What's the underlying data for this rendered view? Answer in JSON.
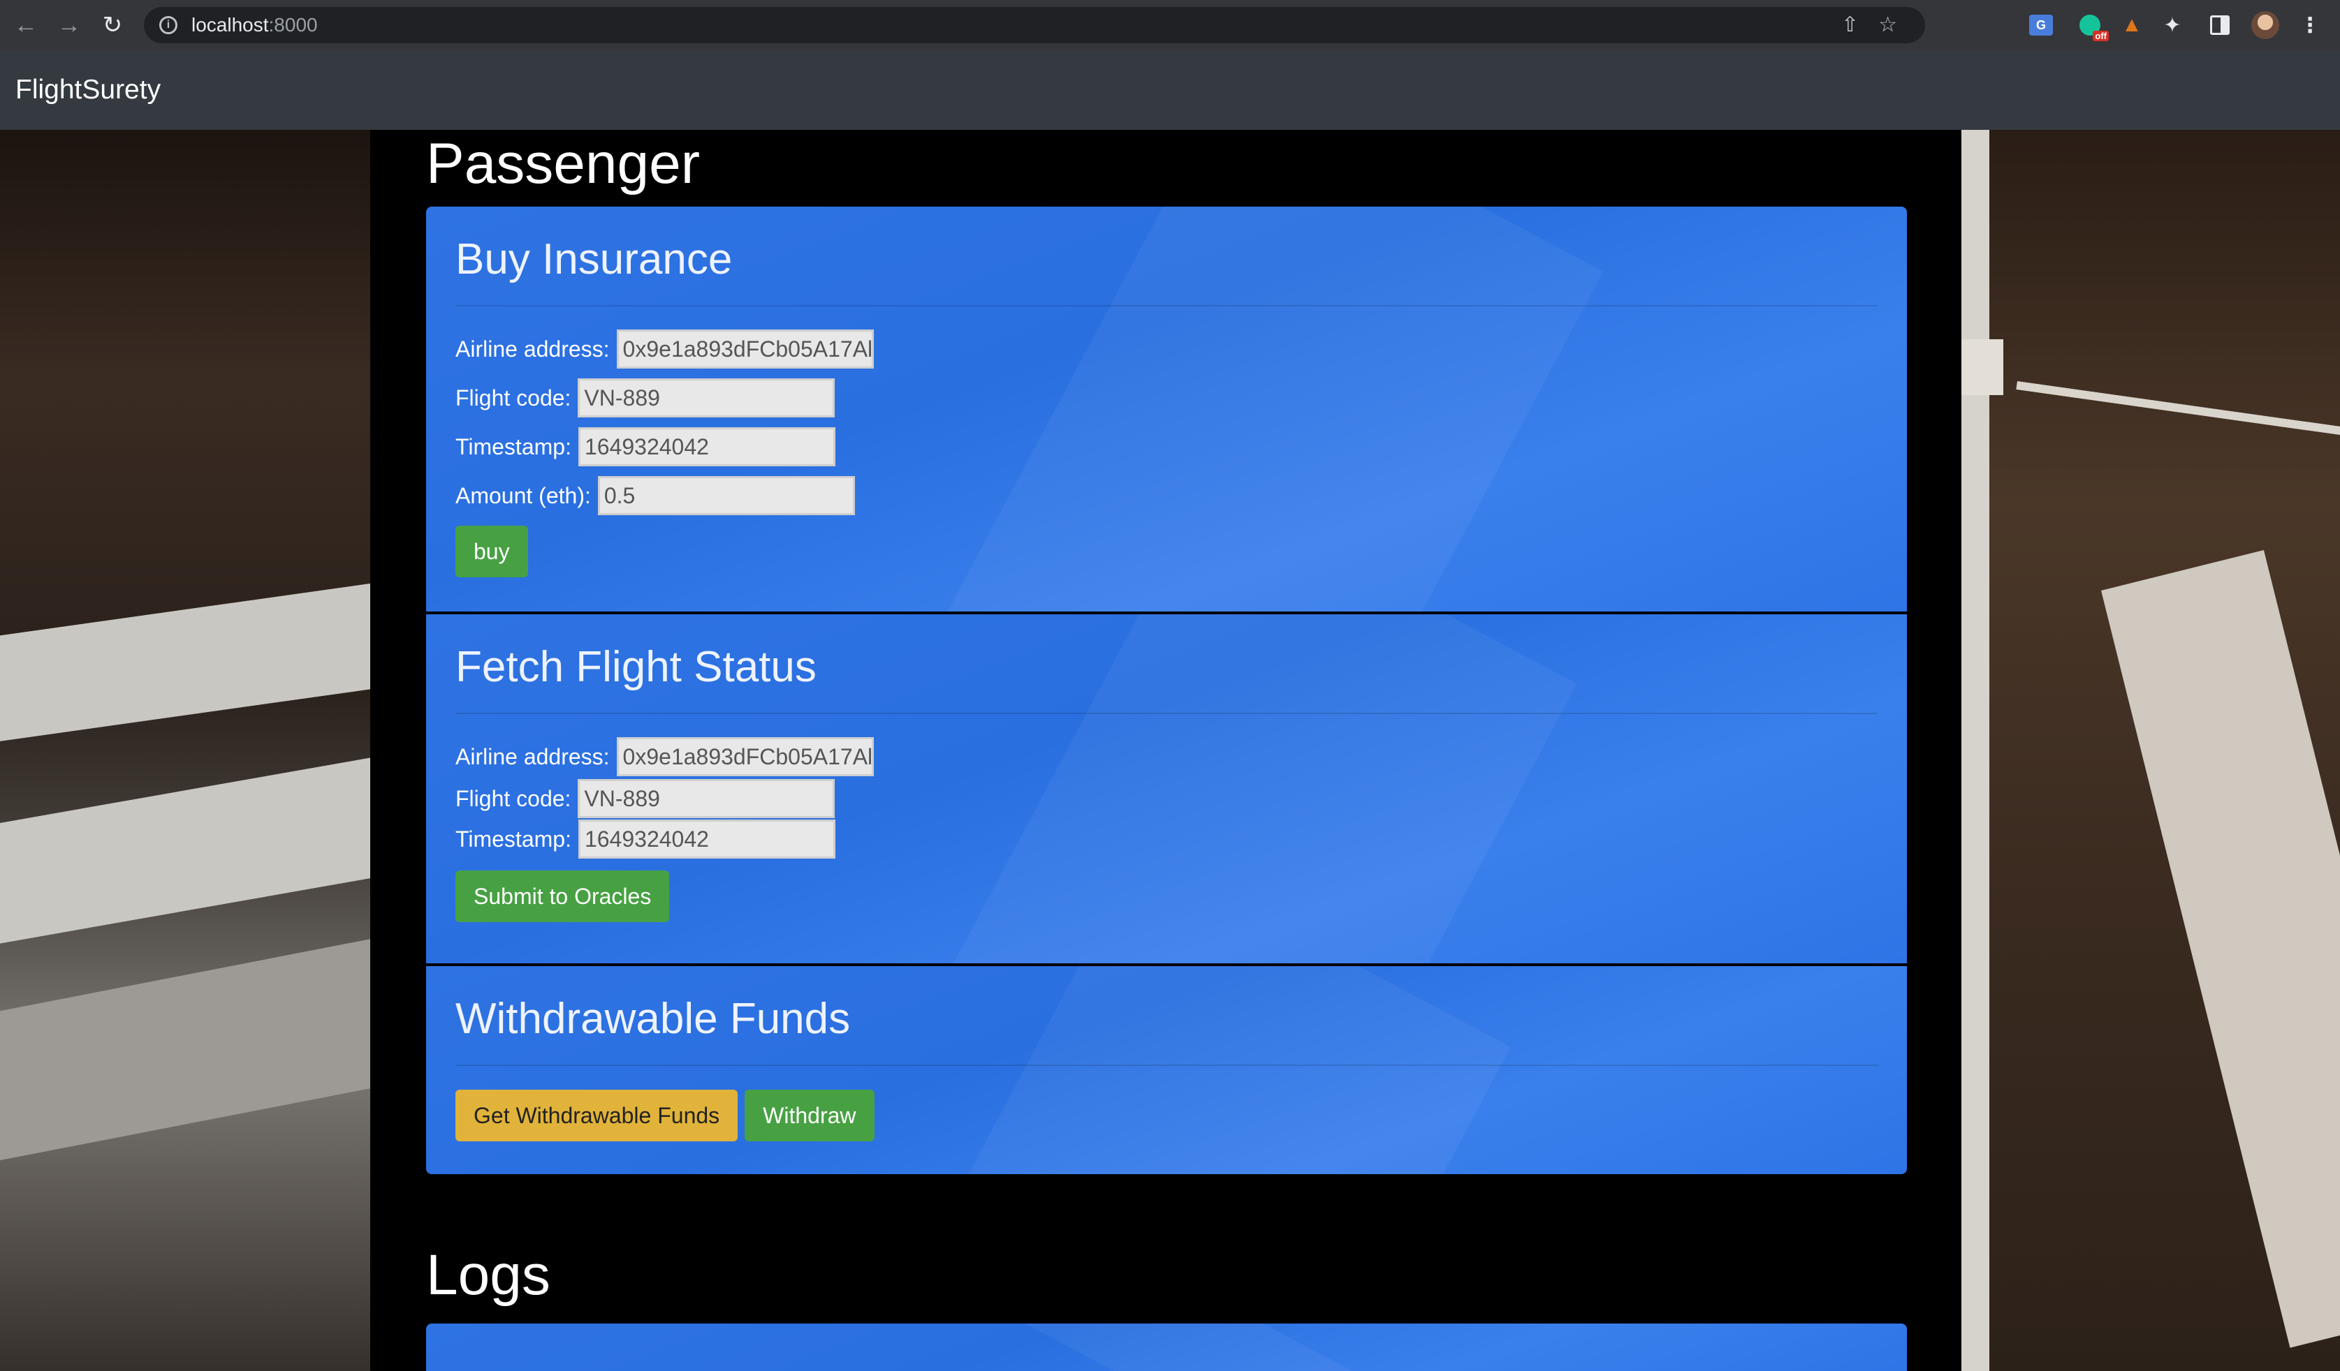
{
  "browser": {
    "url_host": "localhost",
    "url_port": ":8000",
    "grammarly_badge": "off",
    "translate_label": "G"
  },
  "navbar": {
    "brand": "FlightSurety"
  },
  "passenger": {
    "title": "Passenger",
    "buy_insurance": {
      "title": "Buy Insurance",
      "airline_label": "Airline address:",
      "airline_value": "0x9e1a893dFCb05A17Al",
      "flight_label": "Flight code:",
      "flight_value": "VN-889",
      "timestamp_label": "Timestamp:",
      "timestamp_value": "1649324042",
      "amount_label": "Amount (eth):",
      "amount_value": "0.5",
      "buy_button": "buy"
    },
    "fetch_status": {
      "title": "Fetch Flight Status",
      "airline_label": "Airline address:",
      "airline_value": "0x9e1a893dFCb05A17Al",
      "flight_label": "Flight code:",
      "flight_value": "VN-889",
      "timestamp_label": "Timestamp:",
      "timestamp_value": "1649324042",
      "submit_button": "Submit to Oracles"
    },
    "withdrawable": {
      "title": "Withdrawable Funds",
      "get_button": "Get Withdrawable Funds",
      "withdraw_button": "Withdraw"
    }
  },
  "logs": {
    "title": "Logs"
  },
  "colors": {
    "card": "#2f73e3",
    "green": "#47a143",
    "yellow": "#e1b33a",
    "navbar": "#343a40"
  }
}
